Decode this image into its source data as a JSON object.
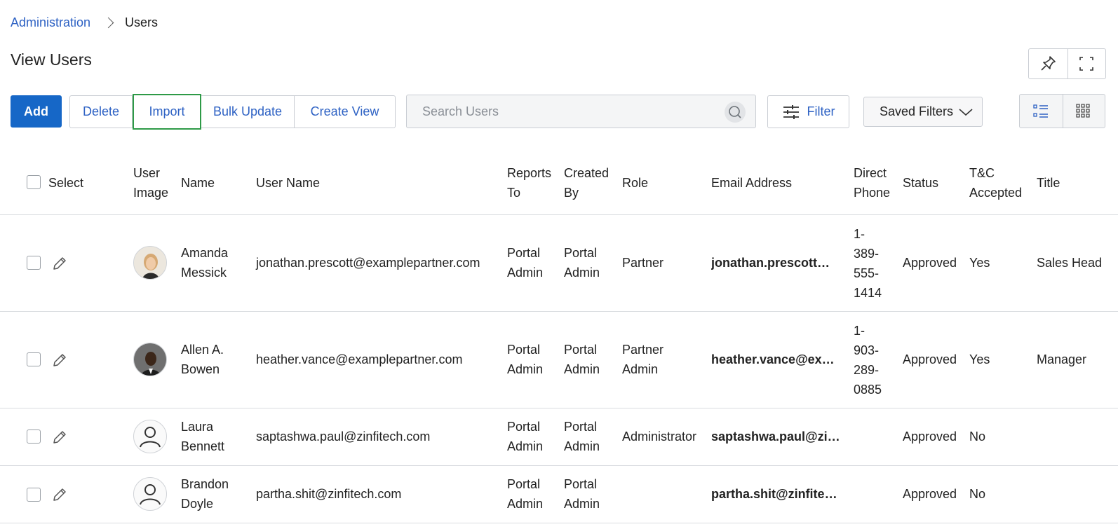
{
  "breadcrumb": {
    "parent": "Administration",
    "current": "Users"
  },
  "page": {
    "title": "View Users"
  },
  "toolbar": {
    "add": "Add",
    "delete": "Delete",
    "import": "Import",
    "bulk_update": "Bulk Update",
    "create_view": "Create View",
    "filter": "Filter",
    "saved_filters": "Saved Filters"
  },
  "search": {
    "placeholder": "Search Users"
  },
  "table": {
    "headers": {
      "select": "Select",
      "user_image_1": "User",
      "user_image_2": "Image",
      "name": "Name",
      "user_name": "User Name",
      "reports_to_1": "Reports",
      "reports_to_2": "To",
      "created_by_1": "Created",
      "created_by_2": "By",
      "role": "Role",
      "email": "Email Address",
      "direct_phone_1": "Direct",
      "direct_phone_2": "Phone",
      "status": "Status",
      "tc_1": "T&C",
      "tc_2": "Accepted",
      "title": "Title"
    },
    "rows": [
      {
        "name1": "Amanda",
        "name2": "Messick",
        "user_name": "jonathan.prescott@examplepartner.com",
        "reports1": "Portal",
        "reports2": "Admin",
        "created1": "Portal",
        "created2": "Admin",
        "role1": "Partner",
        "role2": "",
        "email": "jonathan.prescott@examplepartner.com",
        "phone": [
          "1-",
          "389-",
          "555-",
          "1414"
        ],
        "status": "Approved",
        "tc": "Yes",
        "title": "Sales Head"
      },
      {
        "name1": "Allen A.",
        "name2": "Bowen",
        "user_name": "heather.vance@examplepartner.com",
        "reports1": "Portal",
        "reports2": "Admin",
        "created1": "Portal",
        "created2": "Admin",
        "role1": "Partner",
        "role2": "Admin",
        "email": "heather.vance@examplepartner.com",
        "phone": [
          "1-",
          "903-",
          "289-",
          "0885"
        ],
        "status": "Approved",
        "tc": "Yes",
        "title": "Manager"
      },
      {
        "name1": "Laura",
        "name2": "Bennett",
        "user_name": "saptashwa.paul@zinfitech.com",
        "reports1": "Portal",
        "reports2": "Admin",
        "created1": "Portal",
        "created2": "Admin",
        "role1": "Administrator",
        "role2": "",
        "email": "saptashwa.paul@zinfitech.com",
        "phone": [
          "",
          "",
          "",
          ""
        ],
        "status": "Approved",
        "tc": "No",
        "title": ""
      },
      {
        "name1": "Brandon",
        "name2": "Doyle",
        "user_name": "partha.shit@zinfitech.com",
        "reports1": "Portal",
        "reports2": "Admin",
        "created1": "Portal",
        "created2": "Admin",
        "role1": "",
        "role2": "",
        "email": "partha.shit@zinfitech.com",
        "phone": [
          "",
          "",
          "",
          ""
        ],
        "status": "Approved",
        "tc": "No",
        "title": ""
      }
    ]
  },
  "colors": {
    "accent": "#1667c7",
    "link": "#2e62c4",
    "focus": "#2e9a47"
  }
}
